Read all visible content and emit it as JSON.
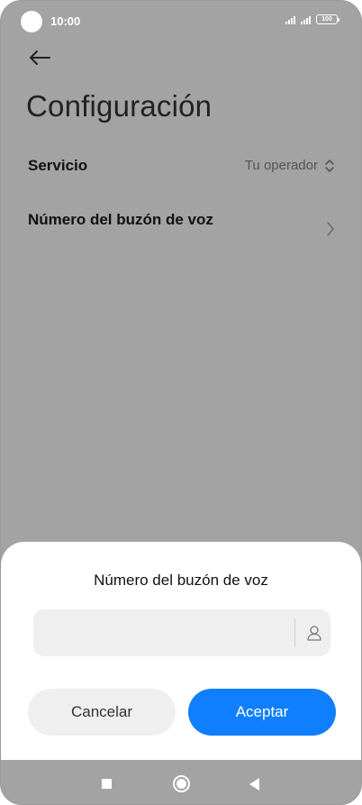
{
  "status_bar": {
    "time": "10:00",
    "battery": "100"
  },
  "header": {
    "back_icon": "arrow-left-icon",
    "title": "Configuración"
  },
  "settings": {
    "service": {
      "label": "Servicio",
      "value": "Tu operador",
      "icon": "up-down-chevron-icon"
    },
    "voicemail_number": {
      "label": "Número del buzón de voz",
      "icon": "chevron-right-icon"
    }
  },
  "dialog": {
    "title": "Número del buzón de voz",
    "input": {
      "value": "",
      "placeholder": ""
    },
    "contact_icon": "person-icon",
    "cancel_label": "Cancelar",
    "accept_label": "Aceptar",
    "accept_color": "#0f7fff"
  },
  "nav_bar": {
    "recents_icon": "square-icon",
    "home_icon": "circle-icon",
    "back_icon": "triangle-back-icon"
  }
}
